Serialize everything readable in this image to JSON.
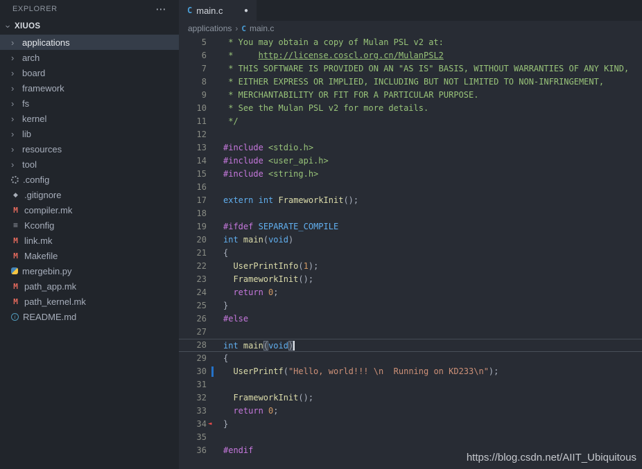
{
  "colors": {
    "editor-bg": "#282c34",
    "sidebar-bg": "#21252b",
    "selection-bg": "#353d49",
    "comment": "#98c379",
    "preproc": "#c678dd",
    "keyword": "#61afef",
    "function": "#dcdcaa",
    "punct": "#abb2bf",
    "number": "#d19a66",
    "string": "#ce9178",
    "include": "#98c379",
    "line-number": "#8a8d85",
    "modified-bar": "#2472c8",
    "error-mark": "#f14c4c",
    "tab-icon": "#4a9fd8",
    "makefile-icon": "#e2695c",
    "info-icon": "#519aba"
  },
  "icons": {
    "chevron_right": "›",
    "chevron_down": "›",
    "gear": "",
    "git": "◆",
    "makefile": "M",
    "list": "≡",
    "python": "",
    "info": "i",
    "error_marker": "◄",
    "c_file": "C"
  },
  "explorer": {
    "title": "EXPLORER",
    "actions_label": "⋯",
    "workspace": "XIUOS",
    "items": [
      {
        "label": "applications",
        "icon": "folder",
        "selected": true
      },
      {
        "label": "arch",
        "icon": "folder"
      },
      {
        "label": "board",
        "icon": "folder"
      },
      {
        "label": "framework",
        "icon": "folder"
      },
      {
        "label": "fs",
        "icon": "folder"
      },
      {
        "label": "kernel",
        "icon": "folder"
      },
      {
        "label": "lib",
        "icon": "folder"
      },
      {
        "label": "resources",
        "icon": "folder"
      },
      {
        "label": "tool",
        "icon": "folder"
      },
      {
        "label": ".config",
        "icon": "gear"
      },
      {
        "label": ".gitignore",
        "icon": "git"
      },
      {
        "label": "compiler.mk",
        "icon": "makefile"
      },
      {
        "label": "Kconfig",
        "icon": "list"
      },
      {
        "label": "link.mk",
        "icon": "makefile"
      },
      {
        "label": "Makefile",
        "icon": "makefile"
      },
      {
        "label": "mergebin.py",
        "icon": "python"
      },
      {
        "label": "path_app.mk",
        "icon": "makefile"
      },
      {
        "label": "path_kernel.mk",
        "icon": "makefile"
      },
      {
        "label": "README.md",
        "icon": "info"
      }
    ]
  },
  "tabbar": {
    "tabs": [
      {
        "label": "main.c",
        "icon": "c_file",
        "modified": true,
        "dot": "●"
      }
    ]
  },
  "breadcrumb": {
    "items": [
      "applications",
      "main.c"
    ],
    "separator": "›"
  },
  "editor": {
    "lines": [
      {
        "n": 5,
        "t": [
          [
            " * You may obtain a copy of Mulan PSL v2 at:",
            "cm"
          ]
        ]
      },
      {
        "n": 6,
        "t": [
          [
            " *     ",
            "cm"
          ],
          [
            "http://license.coscl.org.cn/MulanPSL2",
            "lk"
          ]
        ]
      },
      {
        "n": 7,
        "t": [
          [
            " * THIS SOFTWARE IS PROVIDED ON AN \"AS IS\" BASIS, WITHOUT WARRANTIES OF ANY KIND,",
            "cm"
          ]
        ]
      },
      {
        "n": 8,
        "t": [
          [
            " * EITHER EXPRESS OR IMPLIED, INCLUDING BUT NOT LIMITED TO NON-INFRINGEMENT,",
            "cm"
          ]
        ]
      },
      {
        "n": 9,
        "t": [
          [
            " * MERCHANTABILITY OR FIT FOR A PARTICULAR PURPOSE.",
            "cm"
          ]
        ]
      },
      {
        "n": 10,
        "t": [
          [
            " * See the Mulan PSL v2 for more details.",
            "cm"
          ]
        ]
      },
      {
        "n": 11,
        "t": [
          [
            " */",
            "cm"
          ]
        ]
      },
      {
        "n": 12,
        "t": []
      },
      {
        "n": 13,
        "t": [
          [
            "#include",
            "pp"
          ],
          [
            " ",
            "pn"
          ],
          [
            "<stdio.h>",
            "inc"
          ]
        ]
      },
      {
        "n": 14,
        "t": [
          [
            "#include",
            "pp"
          ],
          [
            " ",
            "pn"
          ],
          [
            "<user_api.h>",
            "inc"
          ]
        ]
      },
      {
        "n": 15,
        "t": [
          [
            "#include",
            "pp"
          ],
          [
            " ",
            "pn"
          ],
          [
            "<string.h>",
            "inc"
          ]
        ]
      },
      {
        "n": 16,
        "t": []
      },
      {
        "n": 17,
        "t": [
          [
            "extern",
            "kw"
          ],
          [
            " ",
            "pn"
          ],
          [
            "int",
            "kw"
          ],
          [
            " ",
            "pn"
          ],
          [
            "FrameworkInit",
            "fn"
          ],
          [
            "();",
            "pn"
          ]
        ]
      },
      {
        "n": 18,
        "t": []
      },
      {
        "n": 19,
        "t": [
          [
            "#ifdef",
            "pp"
          ],
          [
            " ",
            "pn"
          ],
          [
            "SEPARATE_COMPILE",
            "kw"
          ]
        ]
      },
      {
        "n": 20,
        "t": [
          [
            "int",
            "kw"
          ],
          [
            " ",
            "pn"
          ],
          [
            "main",
            "fn"
          ],
          [
            "(",
            "pn"
          ],
          [
            "void",
            "kw"
          ],
          [
            ")",
            "pn"
          ]
        ]
      },
      {
        "n": 21,
        "t": [
          [
            "{",
            "pn"
          ]
        ]
      },
      {
        "n": 22,
        "t": [
          [
            "  ",
            "pn"
          ],
          [
            "UserPrintInfo",
            "fn"
          ],
          [
            "(",
            "pn"
          ],
          [
            "1",
            "nm"
          ],
          [
            ");",
            "pn"
          ]
        ]
      },
      {
        "n": 23,
        "t": [
          [
            "  ",
            "pn"
          ],
          [
            "FrameworkInit",
            "fn"
          ],
          [
            "();",
            "pn"
          ]
        ]
      },
      {
        "n": 24,
        "t": [
          [
            "  ",
            "pn"
          ],
          [
            "return",
            "pp"
          ],
          [
            " ",
            "pn"
          ],
          [
            "0",
            "nm"
          ],
          [
            ";",
            "pn"
          ]
        ]
      },
      {
        "n": 25,
        "t": [
          [
            "}",
            "pn"
          ]
        ]
      },
      {
        "n": 26,
        "t": [
          [
            "#else",
            "pp"
          ]
        ]
      },
      {
        "n": 27,
        "t": []
      },
      {
        "n": 28,
        "cur": true,
        "cursor": true,
        "t": [
          [
            "int",
            "kw"
          ],
          [
            " ",
            "pn"
          ],
          [
            "main",
            "fn"
          ],
          [
            "(",
            "pn bm"
          ],
          [
            "void",
            "kw"
          ],
          [
            ")",
            "pn bm"
          ]
        ]
      },
      {
        "n": 29,
        "t": [
          [
            "{",
            "pn"
          ]
        ]
      },
      {
        "n": 30,
        "mod": true,
        "t": [
          [
            "  ",
            "pn"
          ],
          [
            "UserPrintf",
            "fn"
          ],
          [
            "(",
            "pn"
          ],
          [
            "\"Hello, world!!! \\n  Running on KD233\\n\"",
            "st"
          ],
          [
            ");",
            "pn"
          ]
        ]
      },
      {
        "n": 31,
        "t": []
      },
      {
        "n": 32,
        "t": [
          [
            "  ",
            "pn"
          ],
          [
            "FrameworkInit",
            "fn"
          ],
          [
            "();",
            "pn"
          ]
        ]
      },
      {
        "n": 33,
        "t": [
          [
            "  ",
            "pn"
          ],
          [
            "return",
            "pp"
          ],
          [
            " ",
            "pn"
          ],
          [
            "0",
            "nm"
          ],
          [
            ";",
            "pn"
          ]
        ]
      },
      {
        "n": 34,
        "mark": true,
        "t": [
          [
            "}",
            "pn"
          ]
        ]
      },
      {
        "n": 35,
        "t": []
      },
      {
        "n": 36,
        "t": [
          [
            "#endif",
            "pp"
          ]
        ]
      }
    ]
  },
  "watermark": {
    "text": "https://blog.csdn.net/AIIT_Ubiquitous"
  }
}
